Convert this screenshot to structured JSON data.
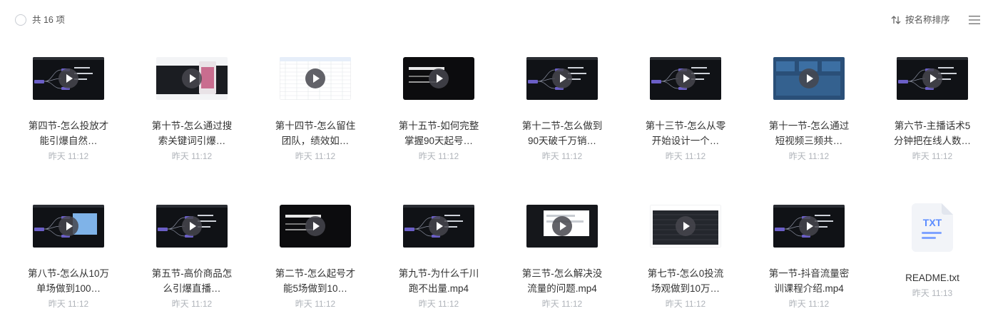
{
  "header": {
    "count_text": "共 16 项",
    "sort_label": "按名称排序"
  },
  "icons": {
    "select_all": "circle-checkbox-icon",
    "sort": "sort-arrows-icon",
    "menu": "hamburger-menu-icon",
    "play": "play-icon",
    "txt": "txt-file-icon"
  },
  "colors": {
    "date": "#b0b4ba",
    "txt_icon": "#5b8cff",
    "node_purple": "#6b5fc7"
  },
  "files": [
    {
      "name": "第四节-怎么投放才能引爆自然…",
      "date": "昨天 11:12",
      "type": "video",
      "thumb": "mindmap-dark"
    },
    {
      "name": "第十节-怎么通过搜索关键词引爆…",
      "date": "昨天 11:12",
      "type": "video",
      "thumb": "phone-screens"
    },
    {
      "name": "第十四节-怎么留住团队，绩效如…",
      "date": "昨天 11:12",
      "type": "video",
      "thumb": "spreadsheet"
    },
    {
      "name": "第十五节-如何完整掌握90天起号…",
      "date": "昨天 11:12",
      "type": "video",
      "thumb": "title-slide"
    },
    {
      "name": "第十二节-怎么做到90天破千万销…",
      "date": "昨天 11:12",
      "type": "video",
      "thumb": "mindmap-dark"
    },
    {
      "name": "第十三节-怎么从零开始设计一个…",
      "date": "昨天 11:12",
      "type": "video",
      "thumb": "mindmap-dark"
    },
    {
      "name": "第十一节-怎么通过短视频三频共…",
      "date": "昨天 11:12",
      "type": "video",
      "thumb": "dashboard-blue"
    },
    {
      "name": "第六节-主播话术5分钟把在线人数…",
      "date": "昨天 11:12",
      "type": "video",
      "thumb": "mindmap-dark"
    },
    {
      "name": "第八节-怎么从10万单场做到100…",
      "date": "昨天 11:12",
      "type": "video",
      "thumb": "mindmap-blue"
    },
    {
      "name": "第五节-高价商品怎么引爆直播…",
      "date": "昨天 11:12",
      "type": "video",
      "thumb": "mindmap-dark"
    },
    {
      "name": "第二节-怎么起号才能5场做到10…",
      "date": "昨天 11:12",
      "type": "video",
      "thumb": "title-slide-2"
    },
    {
      "name": "第九节-为什么千川跑不出量.mp4",
      "date": "昨天 11:12",
      "type": "video",
      "thumb": "mindmap-dark"
    },
    {
      "name": "第三节-怎么解决没流量的问题.mp4",
      "date": "昨天 11:12",
      "type": "video",
      "thumb": "dialog-dark"
    },
    {
      "name": "第七节-怎么0投流场观做到10万…",
      "date": "昨天 11:12",
      "type": "video",
      "thumb": "table-dark"
    },
    {
      "name": "第一节-抖音流量密训课程介绍.mp4",
      "date": "昨天 11:12",
      "type": "video",
      "thumb": "mindmap-dark"
    },
    {
      "name": "README.txt",
      "date": "昨天 11:13",
      "type": "txt",
      "thumb": "txt"
    }
  ]
}
